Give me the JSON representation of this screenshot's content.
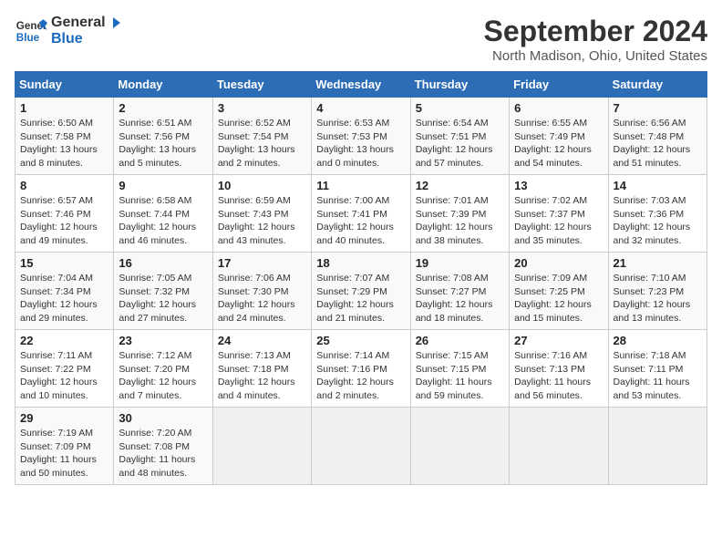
{
  "logo": {
    "line1": "General",
    "line2": "Blue"
  },
  "title": "September 2024",
  "subtitle": "North Madison, Ohio, United States",
  "days_of_week": [
    "Sunday",
    "Monday",
    "Tuesday",
    "Wednesday",
    "Thursday",
    "Friday",
    "Saturday"
  ],
  "weeks": [
    [
      {
        "day": "1",
        "info": "Sunrise: 6:50 AM\nSunset: 7:58 PM\nDaylight: 13 hours\nand 8 minutes."
      },
      {
        "day": "2",
        "info": "Sunrise: 6:51 AM\nSunset: 7:56 PM\nDaylight: 13 hours\nand 5 minutes."
      },
      {
        "day": "3",
        "info": "Sunrise: 6:52 AM\nSunset: 7:54 PM\nDaylight: 13 hours\nand 2 minutes."
      },
      {
        "day": "4",
        "info": "Sunrise: 6:53 AM\nSunset: 7:53 PM\nDaylight: 13 hours\nand 0 minutes."
      },
      {
        "day": "5",
        "info": "Sunrise: 6:54 AM\nSunset: 7:51 PM\nDaylight: 12 hours\nand 57 minutes."
      },
      {
        "day": "6",
        "info": "Sunrise: 6:55 AM\nSunset: 7:49 PM\nDaylight: 12 hours\nand 54 minutes."
      },
      {
        "day": "7",
        "info": "Sunrise: 6:56 AM\nSunset: 7:48 PM\nDaylight: 12 hours\nand 51 minutes."
      }
    ],
    [
      {
        "day": "8",
        "info": "Sunrise: 6:57 AM\nSunset: 7:46 PM\nDaylight: 12 hours\nand 49 minutes."
      },
      {
        "day": "9",
        "info": "Sunrise: 6:58 AM\nSunset: 7:44 PM\nDaylight: 12 hours\nand 46 minutes."
      },
      {
        "day": "10",
        "info": "Sunrise: 6:59 AM\nSunset: 7:43 PM\nDaylight: 12 hours\nand 43 minutes."
      },
      {
        "day": "11",
        "info": "Sunrise: 7:00 AM\nSunset: 7:41 PM\nDaylight: 12 hours\nand 40 minutes."
      },
      {
        "day": "12",
        "info": "Sunrise: 7:01 AM\nSunset: 7:39 PM\nDaylight: 12 hours\nand 38 minutes."
      },
      {
        "day": "13",
        "info": "Sunrise: 7:02 AM\nSunset: 7:37 PM\nDaylight: 12 hours\nand 35 minutes."
      },
      {
        "day": "14",
        "info": "Sunrise: 7:03 AM\nSunset: 7:36 PM\nDaylight: 12 hours\nand 32 minutes."
      }
    ],
    [
      {
        "day": "15",
        "info": "Sunrise: 7:04 AM\nSunset: 7:34 PM\nDaylight: 12 hours\nand 29 minutes."
      },
      {
        "day": "16",
        "info": "Sunrise: 7:05 AM\nSunset: 7:32 PM\nDaylight: 12 hours\nand 27 minutes."
      },
      {
        "day": "17",
        "info": "Sunrise: 7:06 AM\nSunset: 7:30 PM\nDaylight: 12 hours\nand 24 minutes."
      },
      {
        "day": "18",
        "info": "Sunrise: 7:07 AM\nSunset: 7:29 PM\nDaylight: 12 hours\nand 21 minutes."
      },
      {
        "day": "19",
        "info": "Sunrise: 7:08 AM\nSunset: 7:27 PM\nDaylight: 12 hours\nand 18 minutes."
      },
      {
        "day": "20",
        "info": "Sunrise: 7:09 AM\nSunset: 7:25 PM\nDaylight: 12 hours\nand 15 minutes."
      },
      {
        "day": "21",
        "info": "Sunrise: 7:10 AM\nSunset: 7:23 PM\nDaylight: 12 hours\nand 13 minutes."
      }
    ],
    [
      {
        "day": "22",
        "info": "Sunrise: 7:11 AM\nSunset: 7:22 PM\nDaylight: 12 hours\nand 10 minutes."
      },
      {
        "day": "23",
        "info": "Sunrise: 7:12 AM\nSunset: 7:20 PM\nDaylight: 12 hours\nand 7 minutes."
      },
      {
        "day": "24",
        "info": "Sunrise: 7:13 AM\nSunset: 7:18 PM\nDaylight: 12 hours\nand 4 minutes."
      },
      {
        "day": "25",
        "info": "Sunrise: 7:14 AM\nSunset: 7:16 PM\nDaylight: 12 hours\nand 2 minutes."
      },
      {
        "day": "26",
        "info": "Sunrise: 7:15 AM\nSunset: 7:15 PM\nDaylight: 11 hours\nand 59 minutes."
      },
      {
        "day": "27",
        "info": "Sunrise: 7:16 AM\nSunset: 7:13 PM\nDaylight: 11 hours\nand 56 minutes."
      },
      {
        "day": "28",
        "info": "Sunrise: 7:18 AM\nSunset: 7:11 PM\nDaylight: 11 hours\nand 53 minutes."
      }
    ],
    [
      {
        "day": "29",
        "info": "Sunrise: 7:19 AM\nSunset: 7:09 PM\nDaylight: 11 hours\nand 50 minutes."
      },
      {
        "day": "30",
        "info": "Sunrise: 7:20 AM\nSunset: 7:08 PM\nDaylight: 11 hours\nand 48 minutes."
      },
      {
        "day": "",
        "info": ""
      },
      {
        "day": "",
        "info": ""
      },
      {
        "day": "",
        "info": ""
      },
      {
        "day": "",
        "info": ""
      },
      {
        "day": "",
        "info": ""
      }
    ]
  ]
}
